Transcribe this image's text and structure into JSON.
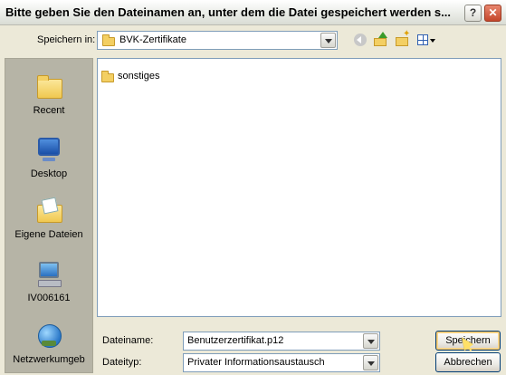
{
  "window": {
    "title": "Bitte geben Sie den Dateinamen an, unter dem die Datei gespeichert werden s...",
    "help_label": "?",
    "close_label": "✕"
  },
  "toolbar": {
    "save_in_label": "Speichern in:",
    "save_in_value": "BVK-Zertifikate"
  },
  "places": [
    {
      "label": "Recent",
      "icon": "recent-icon"
    },
    {
      "label": "Desktop",
      "icon": "desktop-icon"
    },
    {
      "label": "Eigene Dateien",
      "icon": "my-documents-icon"
    },
    {
      "label": "IV006161",
      "icon": "my-computer-icon"
    },
    {
      "label": "Netzwerkumgeb",
      "icon": "network-places-icon"
    }
  ],
  "files": [
    {
      "name": "sonstiges",
      "icon": "folder-icon"
    }
  ],
  "form": {
    "filename_label": "Dateiname:",
    "filename_value": "Benutzerzertifikat.p12",
    "filetype_label": "Dateityp:",
    "filetype_value": "Privater Informationsaustausch"
  },
  "buttons": {
    "save": "Speichern",
    "cancel": "Abbrechen"
  },
  "colors": {
    "dialog_bg": "#ece9d8",
    "places_bg": "#b6b4a6",
    "field_border": "#7f9db9",
    "close_button": "#c4462a"
  }
}
